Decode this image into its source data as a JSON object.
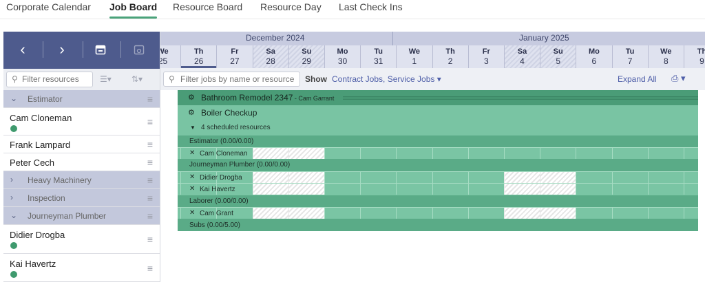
{
  "tabs": [
    {
      "label": "Corporate Calendar",
      "active": false
    },
    {
      "label": "Job Board",
      "active": true
    },
    {
      "label": "Resource Board",
      "active": false
    },
    {
      "label": "Resource Day",
      "active": false
    },
    {
      "label": "Last Check Ins",
      "active": false
    }
  ],
  "left_nav": {
    "prev_icon": "chevron-left-icon",
    "next_icon": "chevron-right-icon",
    "calendar_icon": "calendar-icon",
    "calendar_settings_icon": "calendar-settings-icon",
    "filter_placeholder": "Filter resources"
  },
  "resources": [
    {
      "type": "group",
      "label": "Estimator",
      "expanded": true
    },
    {
      "type": "person",
      "name": "Cam Cloneman",
      "status": true
    },
    {
      "type": "person",
      "name": "Frank Lampard",
      "status": false
    },
    {
      "type": "person",
      "name": "Peter Cech",
      "status": false
    },
    {
      "type": "group",
      "label": "Heavy Machinery",
      "expanded": false
    },
    {
      "type": "group",
      "label": "Inspection",
      "expanded": false
    },
    {
      "type": "group",
      "label": "Journeyman Plumber",
      "expanded": true
    },
    {
      "type": "person",
      "name": "Didier Drogba",
      "status": true
    },
    {
      "type": "person",
      "name": "Kai Havertz",
      "status": true
    }
  ],
  "calendar": {
    "months": [
      "December 2024",
      "January 2025"
    ],
    "days": [
      {
        "dw": "We",
        "dn": "25",
        "weekend": false,
        "today": false
      },
      {
        "dw": "Th",
        "dn": "26",
        "weekend": false,
        "today": true
      },
      {
        "dw": "Fr",
        "dn": "27",
        "weekend": false,
        "today": false
      },
      {
        "dw": "Sa",
        "dn": "28",
        "weekend": true,
        "today": false
      },
      {
        "dw": "Su",
        "dn": "29",
        "weekend": true,
        "today": false
      },
      {
        "dw": "Mo",
        "dn": "30",
        "weekend": false,
        "today": false
      },
      {
        "dw": "Tu",
        "dn": "31",
        "weekend": false,
        "today": false
      },
      {
        "dw": "We",
        "dn": "1",
        "weekend": false,
        "today": false
      },
      {
        "dw": "Th",
        "dn": "2",
        "weekend": false,
        "today": false
      },
      {
        "dw": "Fr",
        "dn": "3",
        "weekend": false,
        "today": false
      },
      {
        "dw": "Sa",
        "dn": "4",
        "weekend": true,
        "today": false
      },
      {
        "dw": "Su",
        "dn": "5",
        "weekend": true,
        "today": false
      },
      {
        "dw": "Mo",
        "dn": "6",
        "weekend": false,
        "today": false
      },
      {
        "dw": "Tu",
        "dn": "7",
        "weekend": false,
        "today": false
      },
      {
        "dw": "We",
        "dn": "8",
        "weekend": false,
        "today": false
      },
      {
        "dw": "Th",
        "dn": "9",
        "weekend": false,
        "today": false
      }
    ]
  },
  "toolbar": {
    "filter_jobs_placeholder": "Filter jobs by name or resource",
    "show_label": "Show",
    "show_value": "Contract Jobs, Service Jobs",
    "expand_all": "Expand All",
    "print_icon": "printer-icon"
  },
  "jobs": {
    "job1_title": "Bathroom Remodel 2347",
    "job1_owner": " - Cam Garrant",
    "job2_title": "Boiler Checkup",
    "scheduled": "4 scheduled resources",
    "estimator_group": "Estimator (0.00/0.00)",
    "estimator_1": "Cam Cloneman",
    "plumber_group": "Journeyman Plumber (0.00/0.00)",
    "plumber_1": "Didier Drogba",
    "plumber_2": "Kai Havertz",
    "laborer_group": "Laborer (0.00/0.00)",
    "laborer_1": "Cam Grant",
    "subs_group": "Subs (0.00/5.00)"
  },
  "colors": {
    "nav_bg": "#4e5b8d",
    "accent_green": "#4aa37a",
    "job_green": "#79c4a3",
    "link_blue": "#4e5ea8"
  }
}
